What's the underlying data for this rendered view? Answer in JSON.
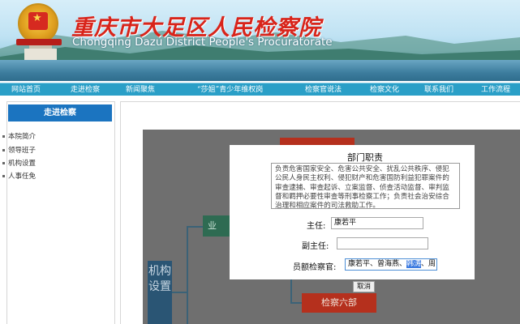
{
  "banner": {
    "title_cn": "重庆市大足区人民检察院",
    "title_en": "Chongqing Dazu District People's Procuratorate"
  },
  "nav": {
    "items": [
      "网站首页",
      "走进检察",
      "新闻聚焦",
      "“莎姐”青少年维权岗",
      "检察官说法",
      "检察文化",
      "联系我们",
      "工作流程"
    ]
  },
  "sidebar": {
    "header": "走进检察",
    "items": [
      "本院简介",
      "领导班子",
      "机构设置",
      "人事任免"
    ]
  },
  "org_chart": {
    "green_box": "业",
    "blue_box": "机构设置",
    "red_bottom": "检察六部"
  },
  "dialog": {
    "title": "部门职责",
    "description": "负责危害国家安全、危害公共安全、扰乱公共秩序、侵犯公民人身民主权利、侵犯财产和危害国防利益犯罪案件的审查逮捕、审查起诉、立案监督、侦查活动监督、审判监督和羁押必要性审查等刑事检察工作；负责社会治安综合治理和相应案件的司法救助工作。",
    "chief_label": "主任:",
    "chief_value": "康若平",
    "deputy_label": "副主任:",
    "deputy_value": "",
    "prosecutors_label": "员额检察官:",
    "prosecutors_before": "康若平、曾海燕、",
    "prosecutors_selected": "韩涛",
    "prosecutors_after": "、周",
    "cancel_label": "取消"
  },
  "colors": {
    "nav_bg": "#2a9fc7",
    "sidebar_header_bg": "#1b74c0",
    "title_red": "#d8241a",
    "org_red": "#b5301d",
    "org_green": "#2e6b52",
    "org_blue": "#2a5574"
  }
}
